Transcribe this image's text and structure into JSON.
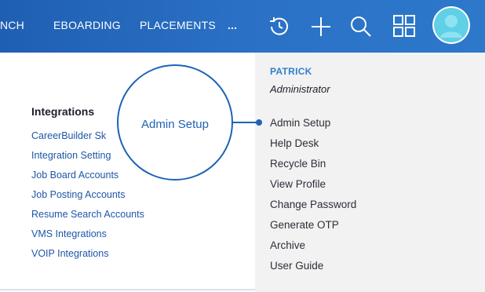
{
  "nav": {
    "items": [
      "NCH",
      "EBOARDING",
      "PLACEMENTS",
      "..."
    ]
  },
  "toolbar": {
    "icons": [
      "history-icon",
      "add-icon",
      "search-icon",
      "apps-grid-icon",
      "avatar"
    ]
  },
  "integrations": {
    "title": "Integrations",
    "links": [
      "CareerBuilder Sk",
      "Integration Setting",
      "Job Board Accounts",
      "Job Posting Accounts",
      "Resume Search Accounts",
      "VMS Integrations",
      "VOIP Integrations"
    ]
  },
  "user_menu": {
    "name": "PATRICK",
    "role": "Administrator",
    "items": [
      "Admin Setup",
      "Help Desk",
      "Recycle Bin",
      "View Profile",
      "Change Password",
      "Generate OTP",
      "Archive",
      "User Guide"
    ]
  },
  "callout": {
    "label": "Admin Setup"
  },
  "colors": {
    "nav_bar": "#2b72c6",
    "accent": "#1e63b4",
    "link": "#1e56a8",
    "menu_bg": "#f2f2f2"
  }
}
